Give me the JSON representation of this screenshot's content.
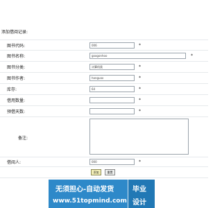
{
  "form": {
    "title": "添加借阅记录:",
    "fields": [
      {
        "label": "图书代码:",
        "value": "006",
        "required": "*"
      },
      {
        "label": "图书名称:",
        "value": "googonhoo",
        "required": "*"
      },
      {
        "label": "图书分类:",
        "value": "计算机类",
        "required": "*"
      },
      {
        "label": "图书作者:",
        "value": "hanguox",
        "required": "*"
      },
      {
        "label": "库存:",
        "value": "64",
        "required": "*"
      },
      {
        "label": "借用数量:",
        "value": "",
        "required": "*"
      },
      {
        "label": "预借天数:",
        "value": "",
        "required": "*"
      },
      {
        "label": "备注:",
        "value": ""
      },
      {
        "label": "借阅人:",
        "value": "000",
        "required": "*"
      }
    ],
    "submit_label": "添加",
    "reset_label": "重置"
  },
  "banner": {
    "line1": "无须担心-自动发货",
    "line2": "www.51topmind.com",
    "badge_line1": "毕业",
    "badge_line2": "设计",
    "color": "#2e89c9"
  }
}
